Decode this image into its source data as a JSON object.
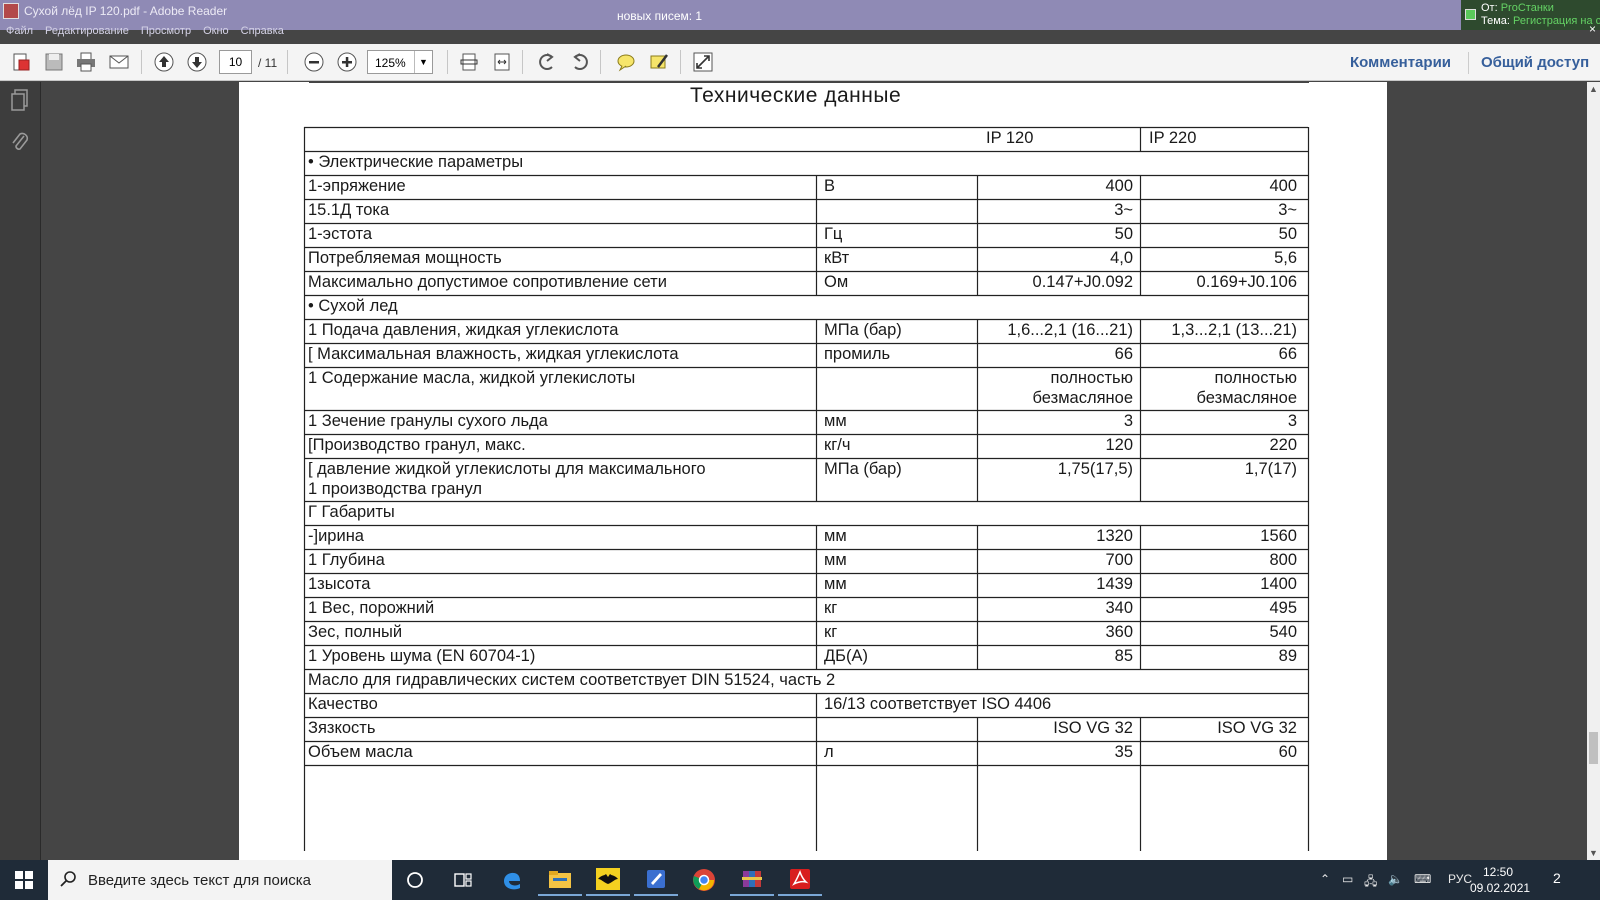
{
  "titlebar": {
    "title": "Сухой лёд IP 120.pdf - Adobe Reader",
    "mail_count": "новых писем: 1",
    "menu": [
      "Файл",
      "Редактирование",
      "Просмотр",
      "Окно",
      "Справка"
    ]
  },
  "notification": {
    "from_label": "От:",
    "from_value": "ProСтанки",
    "subject_label": "Тема:",
    "subject_value": "Регистрация на с",
    "close": "×"
  },
  "toolbar": {
    "page_current": "10",
    "page_total": "/ 11",
    "zoom": "125%",
    "comments": "Комментарии",
    "share": "Общий доступ"
  },
  "document": {
    "title": "Технические данные",
    "header": [
      "",
      "",
      "IP 120",
      "IP 220"
    ],
    "rows": [
      {
        "type": "section",
        "text": "• Электрические параметры"
      },
      {
        "type": "data",
        "label": "1-эпряжение",
        "unit": "В",
        "v1": "400",
        "v2": "400"
      },
      {
        "type": "data",
        "label": "15.1Д тока",
        "unit": "",
        "v1": "3~",
        "v2": "3~"
      },
      {
        "type": "data",
        "label": "1-эстота",
        "unit": "Гц",
        "v1": "50",
        "v2": "50"
      },
      {
        "type": "data",
        "label": " Потребляемая мощность",
        "unit": "кВт",
        "v1": "4,0",
        "v2": "5,6"
      },
      {
        "type": "data",
        "label": "   Максимально допустимое сопротивление сети",
        "unit": "Ом",
        "v1": "0.147+J0.092",
        "v2": "0.169+J0.106"
      },
      {
        "type": "section",
        "text": "• Сухой лед"
      },
      {
        "type": "data",
        "label": " 1 Подача давления, жидкая углекислота",
        "unit": "МПа (бар)",
        "v1": "1,6...2,1 (16...21)",
        "v2": "1,3...2,1 (13...21)"
      },
      {
        "type": "data",
        "label": "[ Максимальная влажность, жидкая углекислота",
        "unit": "промиль",
        "v1": "66",
        "v2": "66"
      },
      {
        "type": "data2",
        "label": "1 Содержание масла, жидкой углекислоты",
        "unit": "",
        "v1a": "полностью",
        "v1b": "безмасляное",
        "v2a": "полностью",
        "v2b": "безмасляное"
      },
      {
        "type": "data",
        "label": "1 Зечение гранулы сухого льда",
        "unit": "мм",
        "v1": "3",
        "v2": "3"
      },
      {
        "type": "data",
        "label": "[Производство гранул, макс.",
        "unit": "кг/ч",
        "v1": "120",
        "v2": "220"
      },
      {
        "type": "data2l",
        "labela": "[ давление жидкой углекислоты для максимального",
        "labelb": "1 производства гранул",
        "unit": "МПа (бар)",
        "v1": "1,75(17,5)",
        "v2": "1,7(17)"
      },
      {
        "type": "section",
        "text": "Г Габариты"
      },
      {
        "type": "data",
        "label": "   -]ирина",
        "unit": "мм",
        "v1": "1320",
        "v2": "1560"
      },
      {
        "type": "data",
        "label": "1 Глубина",
        "unit": "мм",
        "v1": "700",
        "v2": "800"
      },
      {
        "type": "data",
        "label": "1зысота",
        "unit": "мм",
        "v1": "1439",
        "v2": "1400"
      },
      {
        "type": "data",
        "label": "1 Вес, порожний",
        "unit": "кг",
        "v1": "340",
        "v2": "495"
      },
      {
        "type": "data",
        "label": "   Зес, полный",
        "unit": "кг",
        "v1": "360",
        "v2": "540"
      },
      {
        "type": "data",
        "label": "1 Уровень шума (EN 60704-1)",
        "unit": "ДБ(А)",
        "v1": "85",
        "v2": "89"
      },
      {
        "type": "section",
        "text": "   Масло для гидравлических систем соответствует DIN 51524, часть 2"
      },
      {
        "type": "span",
        "label": "   Качество",
        "text": "16/13 соответствует ISO 4406"
      },
      {
        "type": "data",
        "label": "   Зязкость",
        "unit": "",
        "v1": "ISO VG 32",
        "v2": "ISO VG 32"
      },
      {
        "type": "data",
        "label": "   Объем масла",
        "unit": "л",
        "v1": "35",
        "v2": "60"
      },
      {
        "type": "empty"
      }
    ]
  },
  "taskbar": {
    "search_placeholder": "Введите здесь текст для поиска",
    "lang": "РУС",
    "time": "12:50",
    "date": "09.02.2021",
    "notifications": "2"
  }
}
